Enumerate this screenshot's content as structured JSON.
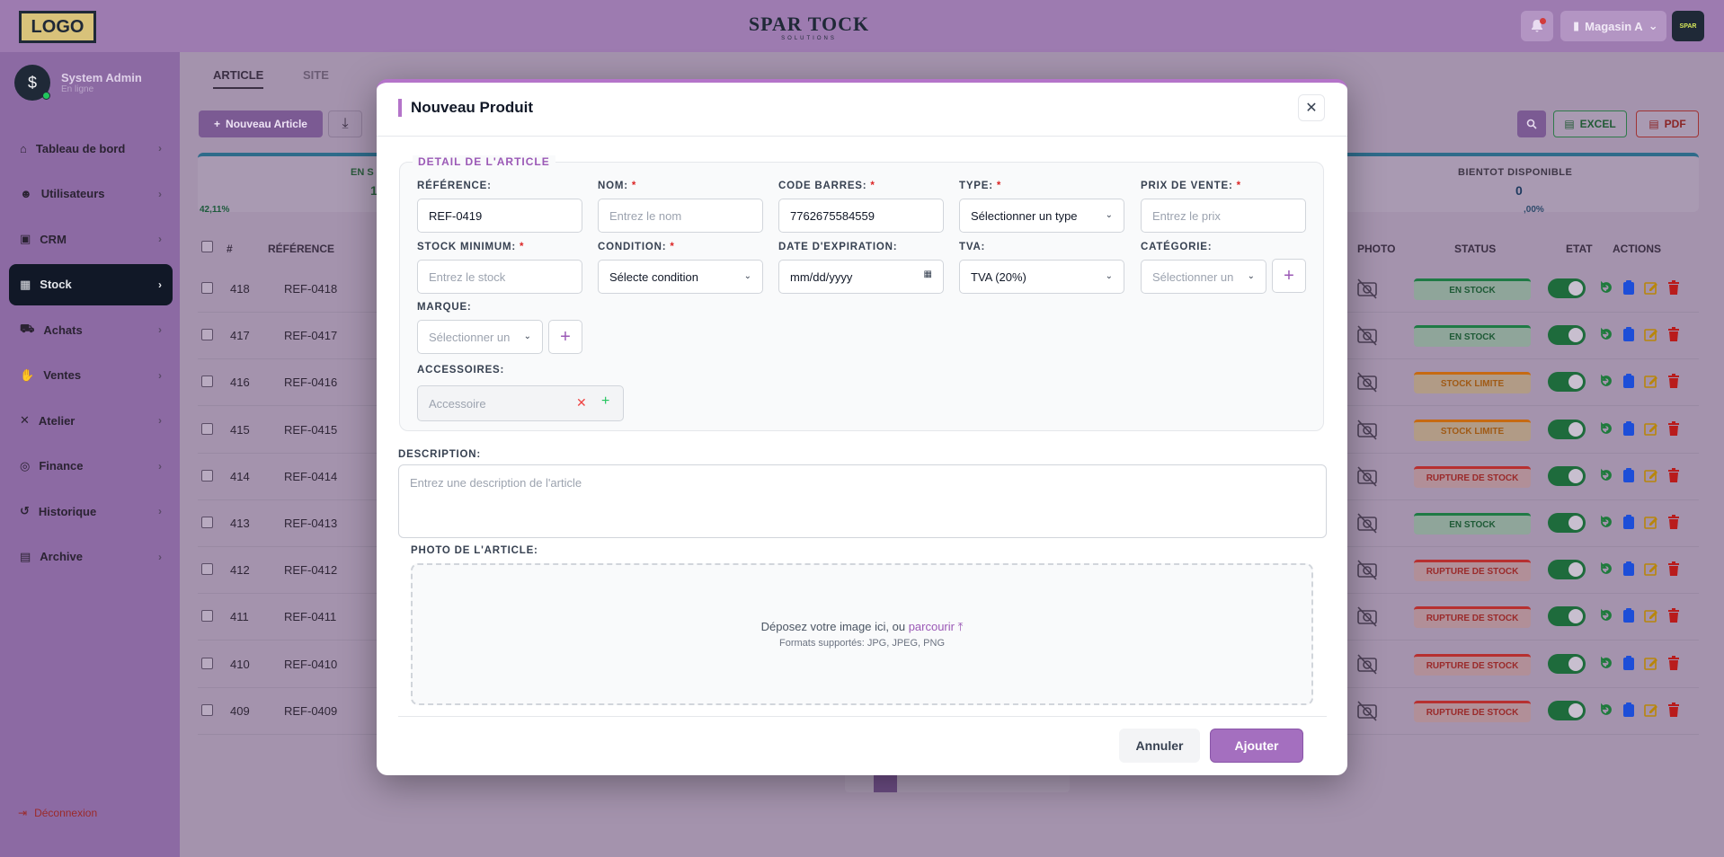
{
  "topbar": {
    "logo": "LOGO",
    "brand_title": "SPAR TOCK",
    "brand_sub": "SOLUTIONS",
    "store": "Magasin A"
  },
  "sidebar": {
    "user_name": "System Admin",
    "user_status": "En ligne",
    "items": [
      {
        "label": "Tableau de bord",
        "icon": "dashboard-icon"
      },
      {
        "label": "Utilisateurs",
        "icon": "users-icon"
      },
      {
        "label": "CRM",
        "icon": "crm-icon"
      },
      {
        "label": "Stock",
        "icon": "stock-icon"
      },
      {
        "label": "Achats",
        "icon": "cart-icon"
      },
      {
        "label": "Ventes",
        "icon": "handshake-icon"
      },
      {
        "label": "Atelier",
        "icon": "tools-icon"
      },
      {
        "label": "Finance",
        "icon": "coins-icon"
      },
      {
        "label": "Historique",
        "icon": "history-icon"
      },
      {
        "label": "Archive",
        "icon": "archive-icon"
      }
    ],
    "logout": "Déconnexion"
  },
  "content": {
    "tabs": [
      "ARTICLE",
      "SITE"
    ],
    "new_article": "Nouveau Article",
    "excel": "EXCEL",
    "pdf": "PDF",
    "kpi_left_head": "EN S",
    "kpi_left_val": "1",
    "kpi_left_pct": "42,11%",
    "kpi_right_head": "BIENTOT DISPONIBLE",
    "kpi_right_val": "0",
    "kpi_right_pct": ",00%",
    "headers": {
      "num": "#",
      "ref": "RÉFÉRENCE",
      "photo": "PHOTO",
      "status": "STATUS",
      "etat": "ETAT",
      "actions": "ACTIONS"
    },
    "rows": [
      {
        "id": "418",
        "ref": "REF-0418",
        "status": "EN STOCK",
        "kind": "ok"
      },
      {
        "id": "417",
        "ref": "REF-0417",
        "status": "EN STOCK",
        "kind": "ok"
      },
      {
        "id": "416",
        "ref": "REF-0416",
        "status": "STOCK LIMITE",
        "kind": "lim"
      },
      {
        "id": "415",
        "ref": "REF-0415",
        "status": "STOCK LIMITE",
        "kind": "lim"
      },
      {
        "id": "414",
        "ref": "REF-0414",
        "status": "RUPTURE DE STOCK",
        "kind": "out"
      },
      {
        "id": "413",
        "ref": "REF-0413",
        "status": "EN STOCK",
        "kind": "ok"
      },
      {
        "id": "412",
        "ref": "REF-0412",
        "status": "RUPTURE DE STOCK",
        "kind": "out"
      },
      {
        "id": "411",
        "ref": "REF-0411",
        "status": "RUPTURE DE STOCK",
        "kind": "out"
      },
      {
        "id": "410",
        "ref": "REF-0410",
        "status": "RUPTURE DE STOCK",
        "kind": "out"
      },
      {
        "id": "409",
        "ref": "REF-0409",
        "status": "RUPTURE DE STOCK",
        "kind": "out"
      }
    ]
  },
  "modal": {
    "title": "Nouveau Produit",
    "legend": "DETAIL DE L'ARTICLE",
    "fields": {
      "reference": {
        "label": "RÉFÉRENCE:",
        "value": "REF-0419"
      },
      "nom": {
        "label": "NOM:",
        "placeholder": "Entrez le nom"
      },
      "code_barres": {
        "label": "CODE BARRES:",
        "value": "7762675584559"
      },
      "type": {
        "label": "TYPE:",
        "value": "Sélectionner un type"
      },
      "prix": {
        "label": "PRIX DE VENTE:",
        "placeholder": "Entrez le prix"
      },
      "stock_min": {
        "label": "STOCK MINIMUM:",
        "placeholder": "Entrez le stock"
      },
      "condition": {
        "label": "CONDITION:",
        "value": "Sélecte condition"
      },
      "date_exp": {
        "label": "DATE D'EXPIRATION:",
        "value": "mm/dd/yyyy"
      },
      "tva": {
        "label": "TVA:",
        "value": "TVA (20%)"
      },
      "categorie": {
        "label": "CATÉGORIE:",
        "placeholder": "Sélectionner un"
      },
      "marque": {
        "label": "MARQUE:",
        "placeholder": "Sélectionner un"
      },
      "accessoires": {
        "label": "ACCESSOIRES:",
        "placeholder": "Accessoire"
      }
    },
    "description": {
      "label": "DESCRIPTION:",
      "placeholder": "Entrez une description de l'article"
    },
    "photo": {
      "label": "PHOTO DE L'ARTICLE:",
      "drop_text": "Déposez votre image ici, ou",
      "browse": "parcourir",
      "formats": "Formats supportés: JPG, JPEG, PNG"
    },
    "cancel": "Annuler",
    "submit": "Ajouter",
    "required_mark": "*"
  }
}
